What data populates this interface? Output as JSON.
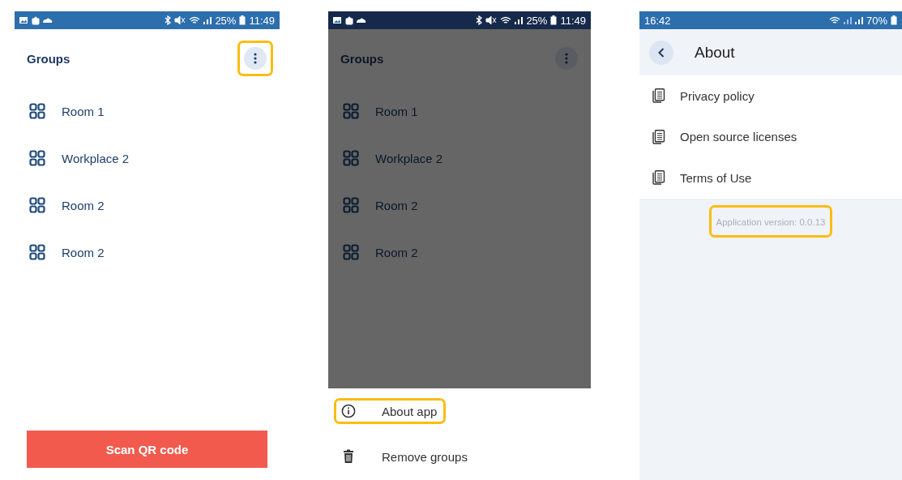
{
  "screens": [
    {
      "kind": "groups",
      "status_bar": {
        "time": "11:49",
        "battery": "25%"
      },
      "title": "Groups",
      "dimmed": false,
      "menu_button": {
        "highlighted": true
      },
      "groups": [
        "Room 1",
        "Workplace 2",
        "Room 2",
        "Room 2"
      ],
      "scan_button": "Scan QR code"
    },
    {
      "kind": "groups",
      "status_bar": {
        "time": "11:49",
        "battery": "25%"
      },
      "title": "Groups",
      "dimmed": true,
      "menu_button": {
        "highlighted": false
      },
      "groups": [
        "Room 1",
        "Workplace 2",
        "Room 2",
        "Room 2"
      ],
      "menu": [
        {
          "kind": "info",
          "label": "About app",
          "highlighted": true
        },
        {
          "kind": "delete",
          "label": "Remove groups",
          "highlighted": false
        }
      ]
    },
    {
      "kind": "about",
      "status_bar": {
        "time": "16:42",
        "battery": "70%"
      },
      "title": "About",
      "links": [
        "Privacy policy",
        "Open source licenses",
        "Terms of Use"
      ],
      "version": {
        "text": "Application version: 0.0.13",
        "highlighted": true
      }
    }
  ]
}
